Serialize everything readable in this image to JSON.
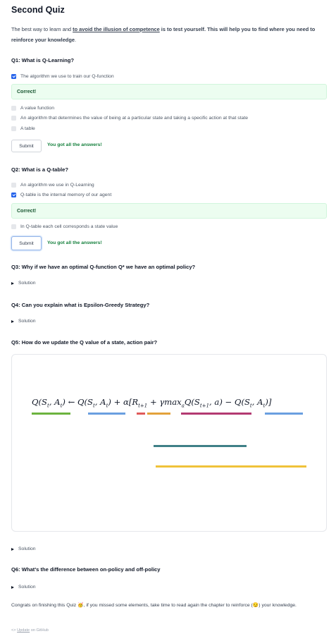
{
  "title": "Second Quiz",
  "intro": {
    "part1": "The best way to learn and ",
    "link": "to avoid the illusion of competence",
    "part2": " is to test yourself. This will help you to find ",
    "bold": "where you need to reinforce your knowledge",
    "part3": "."
  },
  "quiz1": {
    "question": "Q1: What is Q-Learning?",
    "options": [
      {
        "label": "The algorithm we use to train our Q-function",
        "checked": true
      },
      {
        "label": "A value function",
        "checked": false
      },
      {
        "label": "An algorithm that determines the value of being at a particular state and taking a specific action at that state",
        "checked": false
      },
      {
        "label": "A table",
        "checked": false
      }
    ],
    "feedback": "Correct!",
    "submit_label": "Submit",
    "result": "You got all the answers!"
  },
  "quiz2": {
    "question": "Q2: What is a Q-table?",
    "options": [
      {
        "label": "An algorithm we use in Q-Learning",
        "checked": false
      },
      {
        "label": "Q-table is the internal memory of our agent",
        "checked": true
      },
      {
        "label": "In Q-table each cell corresponds a state value",
        "checked": false
      }
    ],
    "feedback": "Correct!",
    "submit_label": "Submit",
    "result": "You got all the answers!"
  },
  "q3": {
    "question": "Q3: Why if we have an optimal Q-function Q* we have an optimal policy?",
    "solution": "Solution"
  },
  "q4": {
    "question": "Q4: Can you explain what is Epsilon-Greedy Strategy?",
    "solution": "Solution"
  },
  "q5": {
    "question": "Q5: How do we update the Q value of a state, action pair?",
    "formula": "Q(St, At) ← Q(St, At) + α[Rt+1 + γmaxaQ(St+1, a) − Q(St, At)]",
    "bar_colors": {
      "green": "#6cb33f",
      "blue": "#6a9fe0",
      "red": "#e05a5a",
      "orange": "#e3a23b",
      "magenta": "#b33a72",
      "teal": "#3f8087",
      "yellow": "#f0c23a"
    },
    "solution": "Solution"
  },
  "q6": {
    "question": "Q6: What's the difference between on-policy and off-policy",
    "solution": "Solution"
  },
  "outro": {
    "part1": "Congrats on finishing this Quiz ",
    "emoji1": "🥳",
    "part2": ", if you missed some elements, take time to read again the chapter to reinforce (",
    "emoji2": "😏",
    "part3": ") your knowledge."
  },
  "github": {
    "arrow": "<>",
    "link": "Update",
    "suffix": " on GitHub"
  }
}
